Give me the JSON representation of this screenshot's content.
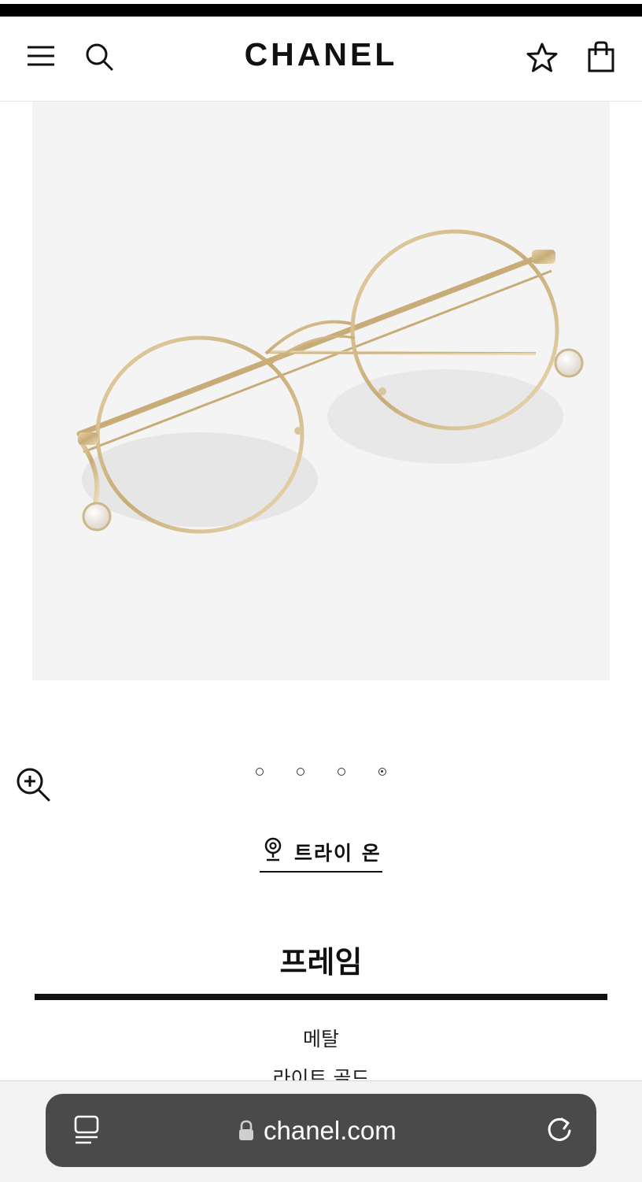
{
  "header": {
    "brand": "CHANEL",
    "icons": [
      "menu-icon",
      "search-icon",
      "wishlist-star-icon",
      "shopping-bag-icon"
    ]
  },
  "gallery": {
    "image": "gold-round-eyeglasses",
    "slide_count": 4,
    "active_slide": 4,
    "zoom_icon": "zoom-in-icon"
  },
  "try_on": {
    "label": "트라이 온",
    "icon": "location-pin-icon"
  },
  "frame_section": {
    "title": "프레임",
    "attributes": [
      "메탈",
      "라이트 골드"
    ]
  },
  "browser": {
    "url": "chanel.com",
    "icons": [
      "tabs-icon",
      "lock-icon",
      "reload-icon"
    ],
    "colors": {
      "urlbar": "#4a4a4a",
      "toolbar": "#f3f3f3"
    }
  }
}
